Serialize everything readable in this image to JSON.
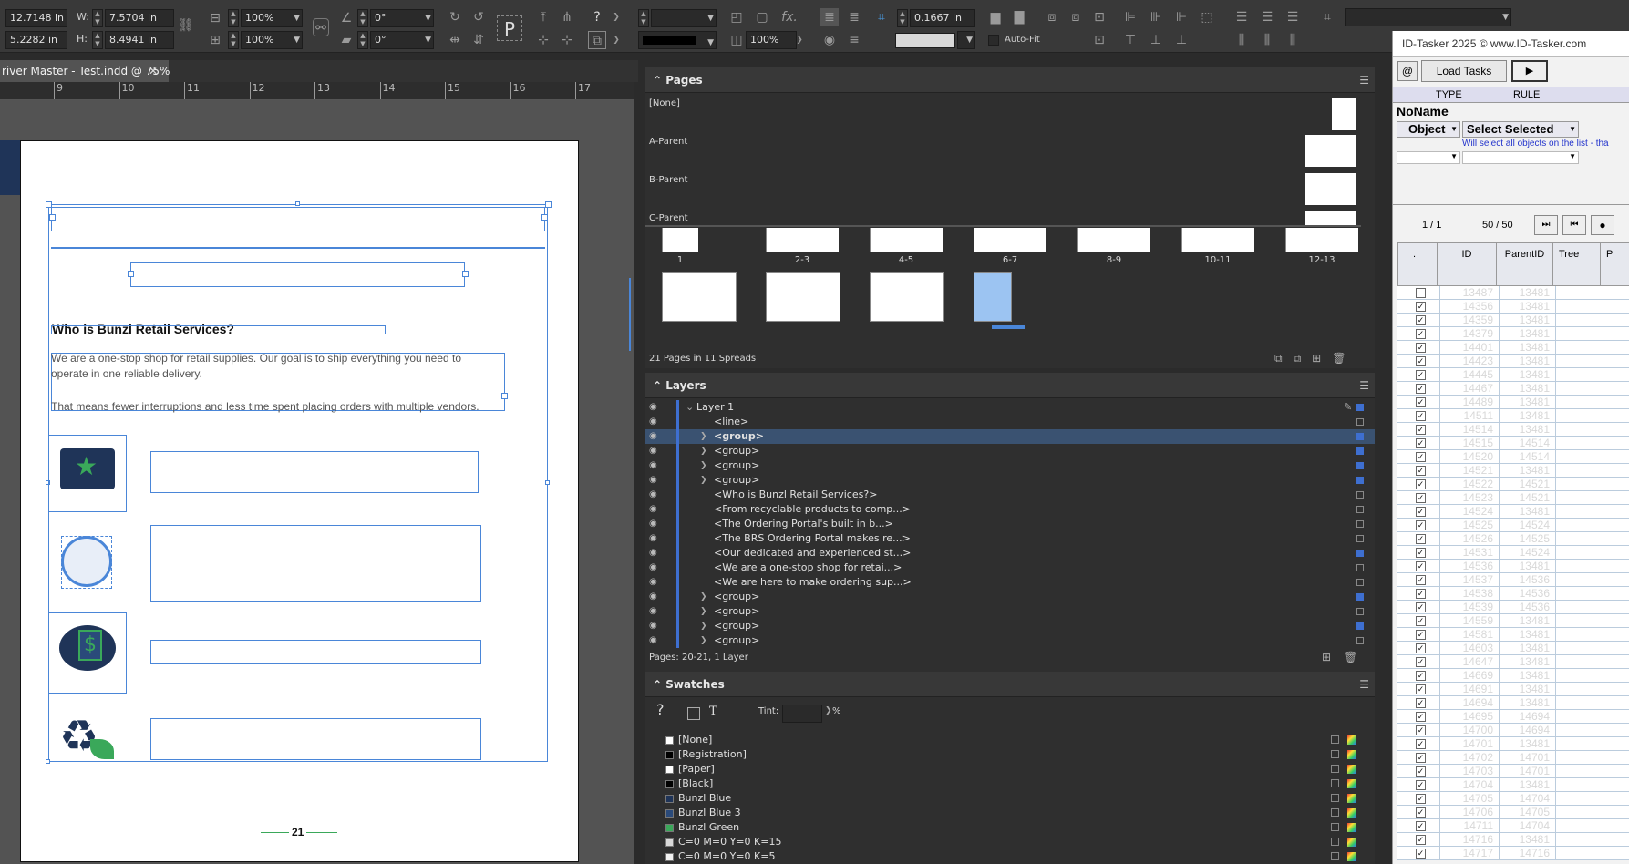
{
  "control_bar": {
    "x": "12.7148 in",
    "y": "5.2282 in",
    "w_label": "W:",
    "h_label": "H:",
    "w": "7.5704 in",
    "h": "8.4941 in",
    "scale_x": "100%",
    "scale_y": "100%",
    "rotate": "0°",
    "shear": "0°",
    "stroke_weight": "0.1667 in",
    "opacity": "100%",
    "auto_fit": "Auto-Fit"
  },
  "document": {
    "tab_title": "river Master - Test.indd @ 75%",
    "ruler_ticks": [
      "9",
      "10",
      "11",
      "12",
      "13",
      "14",
      "15",
      "16",
      "17"
    ],
    "heading": "Who is Bunzl Retail Services?",
    "para1": "We are a one-stop shop for retail supplies. Our goal is to ship everything you need to",
    "para1b": "operate in one reliable delivery.",
    "para2": "That means fewer interruptions and less time spent placing orders with multiple vendors.",
    "page_number": "21"
  },
  "pages_panel": {
    "title": "Pages",
    "parents": [
      "[None]",
      "A-Parent",
      "B-Parent",
      "C-Parent"
    ],
    "spread_labels": [
      "1",
      "2-3",
      "4-5",
      "6-7",
      "8-9",
      "10-11",
      "12-13"
    ],
    "footer": "21 Pages in 11 Spreads"
  },
  "layers_panel": {
    "title": "Layers",
    "layer_name": "Layer 1",
    "items": [
      {
        "label": "<line>",
        "expand": false
      },
      {
        "label": "<group>",
        "expand": true
      },
      {
        "label": "<group>",
        "expand": true
      },
      {
        "label": "<group>",
        "expand": true
      },
      {
        "label": "<group>",
        "expand": true
      },
      {
        "label": "<Who is Bunzl Retail Services?>",
        "expand": false
      },
      {
        "label": "<From recyclable products to comp...>",
        "expand": false
      },
      {
        "label": "<The Ordering Portal's built in b...>",
        "expand": false
      },
      {
        "label": "<The BRS Ordering Portal makes re...>",
        "expand": false
      },
      {
        "label": "<Our dedicated and experienced st...>",
        "expand": false
      },
      {
        "label": "<We are a one-stop shop for retai...>",
        "expand": false
      },
      {
        "label": "<We are here to make ordering sup...>",
        "expand": false
      },
      {
        "label": "<group>",
        "expand": true
      },
      {
        "label": "<group>",
        "expand": true
      },
      {
        "label": "<group>",
        "expand": true
      },
      {
        "label": "<group>",
        "expand": true
      }
    ],
    "footer": "Pages: 20-21, 1 Layer"
  },
  "swatches_panel": {
    "title": "Swatches",
    "tint_label": "Tint:",
    "tint_unit": "%",
    "items": [
      {
        "name": "[None]",
        "color": "#ffffff"
      },
      {
        "name": "[Registration]",
        "color": "#000000"
      },
      {
        "name": "[Paper]",
        "color": "#ffffff"
      },
      {
        "name": "[Black]",
        "color": "#000000"
      },
      {
        "name": "Bunzl Blue",
        "color": "#1f3458"
      },
      {
        "name": "Bunzl Blue 3",
        "color": "#2a4a7a"
      },
      {
        "name": "Bunzl Green",
        "color": "#3aa85a"
      },
      {
        "name": "C=0 M=0 Y=0 K=15",
        "color": "#d9d9d9"
      },
      {
        "name": "C=0 M=0 Y=0 K=5",
        "color": "#f2f2f2"
      }
    ]
  },
  "tasker": {
    "title": "ID-Tasker 2025  © www.ID-Tasker.com",
    "at_button": "@",
    "load_tasks": "Load Tasks",
    "col_type": "TYPE",
    "col_rule": "RULE",
    "name": "NoName",
    "object": "Object",
    "select_selected": "Select Selected",
    "hint": "Will select all objects on the list - tha",
    "pager_left": "1 / 1",
    "pager_right": "50 / 50",
    "grid_headers": [
      ".",
      "ID",
      "ParentID",
      "Tree",
      "P"
    ],
    "rows": [
      {
        "id": "13487",
        "pid": "13481",
        "checked": false
      },
      {
        "id": "14356",
        "pid": "13481",
        "checked": true
      },
      {
        "id": "14359",
        "pid": "13481",
        "checked": true
      },
      {
        "id": "14379",
        "pid": "13481",
        "checked": true
      },
      {
        "id": "14401",
        "pid": "13481",
        "checked": true
      },
      {
        "id": "14423",
        "pid": "13481",
        "checked": true
      },
      {
        "id": "14445",
        "pid": "13481",
        "checked": true
      },
      {
        "id": "14467",
        "pid": "13481",
        "checked": true
      },
      {
        "id": "14489",
        "pid": "13481",
        "checked": true
      },
      {
        "id": "14511",
        "pid": "13481",
        "checked": true
      },
      {
        "id": "14514",
        "pid": "13481",
        "checked": true
      },
      {
        "id": "14515",
        "pid": "14514",
        "checked": true
      },
      {
        "id": "14520",
        "pid": "14514",
        "checked": true
      },
      {
        "id": "14521",
        "pid": "13481",
        "checked": true
      },
      {
        "id": "14522",
        "pid": "14521",
        "checked": true
      },
      {
        "id": "14523",
        "pid": "14521",
        "checked": true
      },
      {
        "id": "14524",
        "pid": "13481",
        "checked": true
      },
      {
        "id": "14525",
        "pid": "14524",
        "checked": true
      },
      {
        "id": "14526",
        "pid": "14525",
        "checked": true
      },
      {
        "id": "14531",
        "pid": "14524",
        "checked": true
      },
      {
        "id": "14536",
        "pid": "13481",
        "checked": true
      },
      {
        "id": "14537",
        "pid": "14536",
        "checked": true
      },
      {
        "id": "14538",
        "pid": "14536",
        "checked": true
      },
      {
        "id": "14539",
        "pid": "14536",
        "checked": true
      },
      {
        "id": "14559",
        "pid": "13481",
        "checked": true
      },
      {
        "id": "14581",
        "pid": "13481",
        "checked": true
      },
      {
        "id": "14603",
        "pid": "13481",
        "checked": true
      },
      {
        "id": "14647",
        "pid": "13481",
        "checked": true
      },
      {
        "id": "14669",
        "pid": "13481",
        "checked": true
      },
      {
        "id": "14691",
        "pid": "13481",
        "checked": true
      },
      {
        "id": "14694",
        "pid": "13481",
        "checked": true
      },
      {
        "id": "14695",
        "pid": "14694",
        "checked": true
      },
      {
        "id": "14700",
        "pid": "14694",
        "checked": true
      },
      {
        "id": "14701",
        "pid": "13481",
        "checked": true
      },
      {
        "id": "14702",
        "pid": "14701",
        "checked": true
      },
      {
        "id": "14703",
        "pid": "14701",
        "checked": true
      },
      {
        "id": "14704",
        "pid": "13481",
        "checked": true
      },
      {
        "id": "14705",
        "pid": "14704",
        "checked": true
      },
      {
        "id": "14706",
        "pid": "14705",
        "checked": true
      },
      {
        "id": "14711",
        "pid": "14704",
        "checked": true
      },
      {
        "id": "14716",
        "pid": "13481",
        "checked": true
      },
      {
        "id": "14717",
        "pid": "14716",
        "checked": true
      }
    ]
  }
}
